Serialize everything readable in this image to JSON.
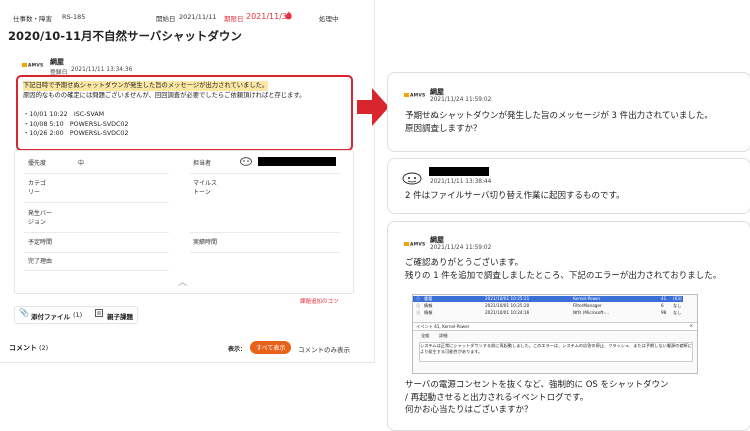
{
  "issue": {
    "header": {
      "category": "仕事数・障害",
      "id": "RS-185",
      "created_label": "開始日",
      "created_date": "2021/11/11",
      "due_label": "期限日",
      "due_date": "2021/11/30",
      "status": "処理中"
    },
    "title": "2020/10-11月不自然サーバシャットダウン",
    "post": {
      "logo": "AMVS",
      "author": "綱屋",
      "date_label": "登録日",
      "date": "2021/11/11 13:34:36",
      "line1": "下記日時で予期せぬシャットダウンが発生した旨のメッセージが出力されていました。",
      "line2": "原因的なものの確定には問題ございませんが、回回調査が必要でしたらご依頼頂ければと存じます。",
      "entries": [
        "・10/01 10:22　ISC-SVAM",
        "・10/08 5:10　POWERSL-SVDC02",
        "・10/26 2:00　POWERSL-SVDC02"
      ]
    },
    "fields": {
      "priority_label": "優先度",
      "priority_value": "中",
      "assignee_label": "担当者",
      "category_label": "カテゴ\nリー",
      "milestone_label": "マイルス\nトーン",
      "version_label": "発生バー\nジョン",
      "planned_label": "予定時間",
      "actual_label": "実績時間",
      "resolution_label": "完了理由"
    },
    "history_link": "課題追加のコツ",
    "attachments": {
      "label": "添付ファイル",
      "count": "(1)",
      "subtasks": "親子課題"
    },
    "comments": {
      "label": "コメント",
      "count": "(2)",
      "display_label": "表示：",
      "show_all": "すべて表示",
      "comments_only": "コメントのみ表示"
    }
  },
  "cards": [
    {
      "logo": "AMVS",
      "author": "綱屋",
      "date": "2021/11/24 11:59:02",
      "lines": [
        "予期せぬシャットダウンが発生した旨のメッセージが 3 件出力されていました。",
        "原因調査しますか？"
      ]
    },
    {
      "date": "2021/11/11 13:38:44",
      "lines": [
        "2 件はファイルサーバ切り替え作業に起因するものです。"
      ]
    },
    {
      "logo": "AMVS",
      "author": "綱屋",
      "date": "2021/11/24 11:59:02",
      "lines": [
        "ご確認ありがとうございます。",
        "残りの 1 件を追加で調査しましたところ、下記のエラーが出力されておりました。"
      ],
      "lines_after": [
        "サーバの電源コンセントを抜くなど、強制的に OS をシャットダウン",
        "/ 再起動させると出力されるイベントログです。",
        "何かお心当たりはございますか？"
      ],
      "event_viewer": {
        "rows": [
          {
            "level": "重要",
            "date": "2021/10/01 10:25:21",
            "source": "Kernel-Power",
            "id": "41",
            "task": "(63)"
          },
          {
            "level": "情報",
            "date": "2021/10/01 10:25:20",
            "source": "FilterManager",
            "id": "6",
            "task": "なし"
          },
          {
            "level": "情報",
            "date": "2021/10/01 10:24:16",
            "source": "Ntfs (Microsoft-...",
            "id": "98",
            "task": "なし"
          }
        ],
        "title": "イベント 41, Kernel-Power",
        "tabs": [
          "全般",
          "詳細"
        ],
        "message": "システムは正常にシャットダウンする前に再起動しました。このエラーは、システムの応答の停止、クラッシュ、または予期しない電源の遮断により発生する可能性があります。"
      }
    }
  ],
  "colors": {
    "accent": "#e8621a",
    "alert": "#d9262e",
    "highlight": "#fce8a4"
  }
}
